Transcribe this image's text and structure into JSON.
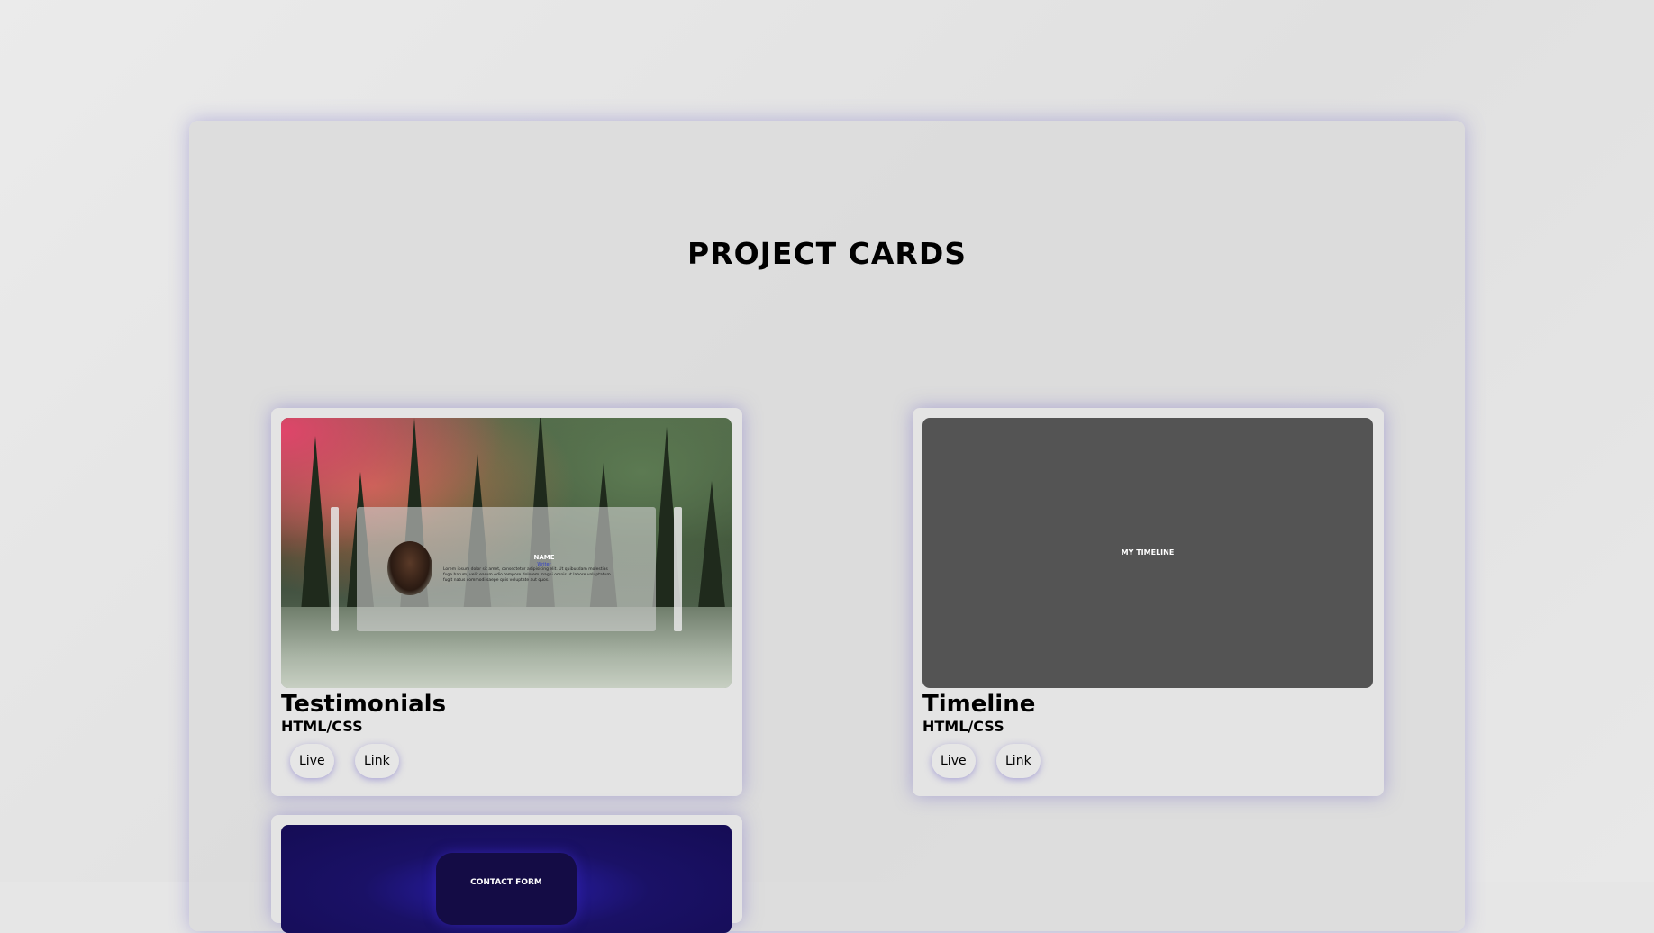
{
  "page": {
    "title": "PROJECT CARDS"
  },
  "cards": [
    {
      "title": "Testimonials",
      "subtitle": "HTML/CSS",
      "live_label": "Live",
      "link_label": "Link",
      "thumbnail": {
        "name": "NAME",
        "role": "Writer",
        "text": "Lorem ipsum dolor sit amet, consectetur adipisicing elit. Ut quibusdam molestias fuga harum, velit earum odio tempore dolorem magni omnis ut labore voluptatum fugit natus commodi saepe quis voluptate aut quos."
      }
    },
    {
      "title": "Timeline",
      "subtitle": "HTML/CSS",
      "live_label": "Live",
      "link_label": "Link",
      "thumbnail": {
        "label": "MY TIMELINE"
      }
    },
    {
      "thumbnail": {
        "label": "CONTACT FORM"
      }
    }
  ]
}
